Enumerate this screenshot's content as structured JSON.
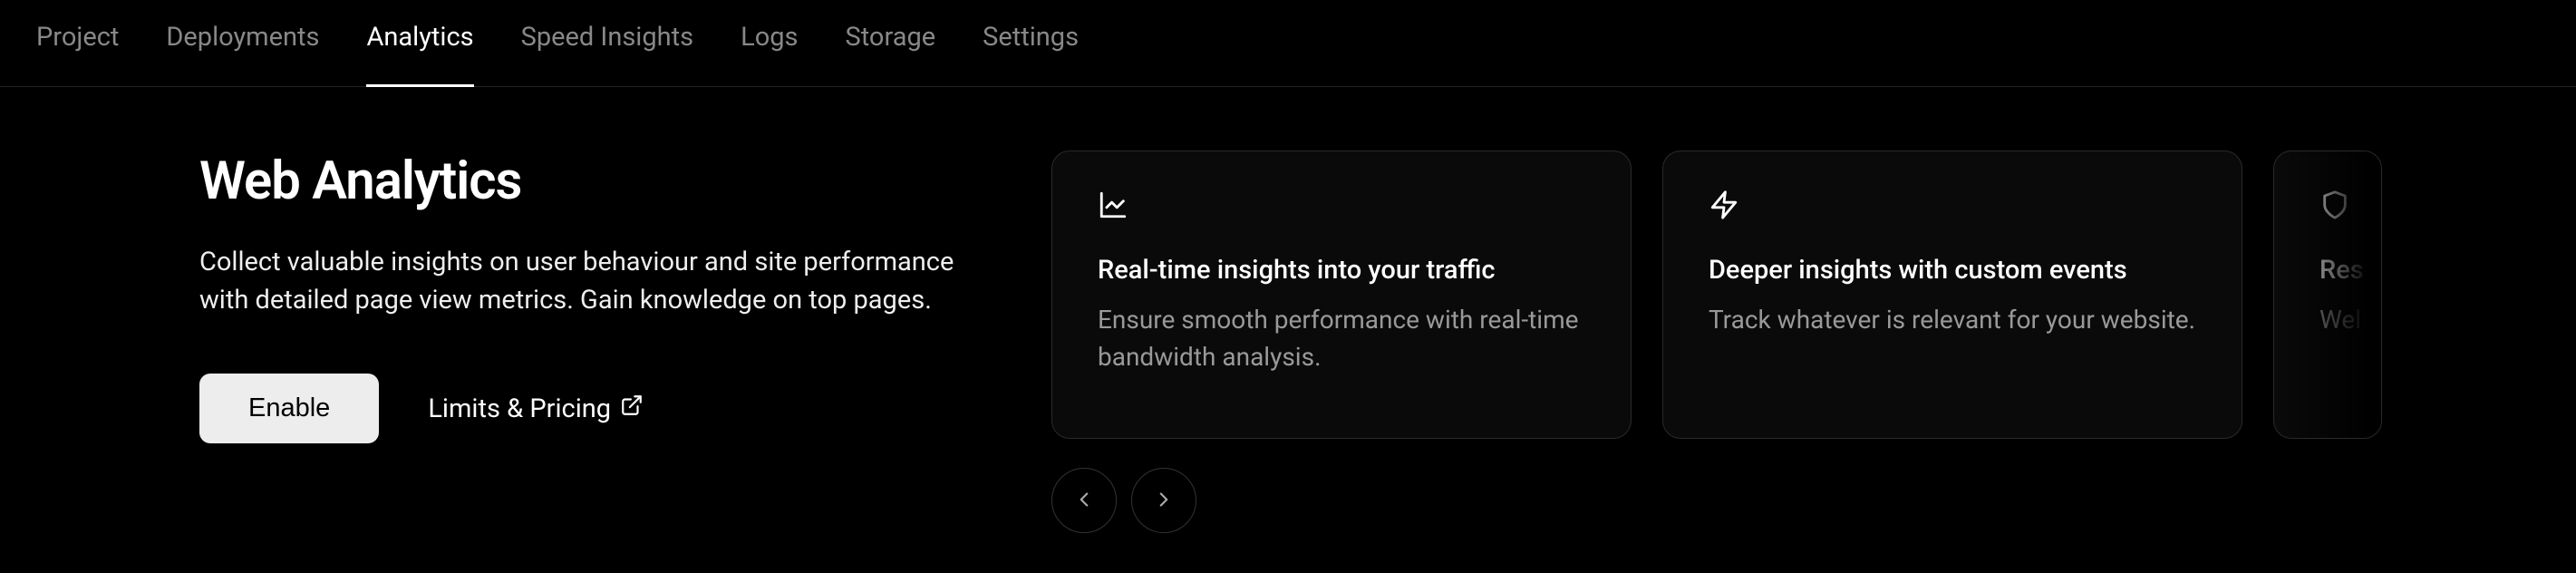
{
  "nav": {
    "items": [
      {
        "label": "Project",
        "active": false
      },
      {
        "label": "Deployments",
        "active": false
      },
      {
        "label": "Analytics",
        "active": true
      },
      {
        "label": "Speed Insights",
        "active": false
      },
      {
        "label": "Logs",
        "active": false
      },
      {
        "label": "Storage",
        "active": false
      },
      {
        "label": "Settings",
        "active": false
      }
    ]
  },
  "page": {
    "title": "Web Analytics",
    "description": "Collect valuable insights on user behaviour and site performance with detailed page view metrics. Gain knowledge on top pages."
  },
  "actions": {
    "enable_label": "Enable",
    "pricing_label": "Limits & Pricing"
  },
  "cards": [
    {
      "icon": "chart-line-icon",
      "title": "Real-time insights into your traffic",
      "description": "Ensure smooth performance with real-time bandwidth analysis."
    },
    {
      "icon": "lightning-icon",
      "title": "Deeper insights with custom events",
      "description": "Track whatever is relevant for your website."
    },
    {
      "icon": "shield-icon",
      "title": "Res",
      "description": "Wel and"
    }
  ]
}
